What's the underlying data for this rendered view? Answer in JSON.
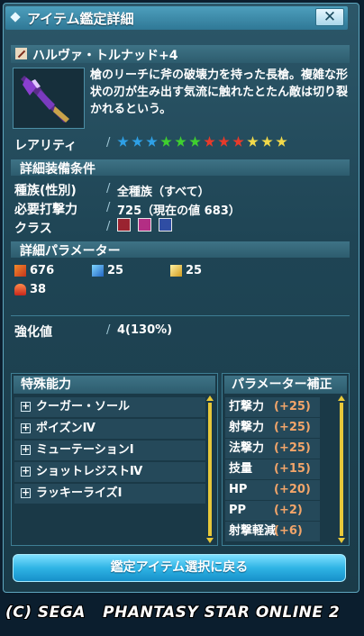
{
  "window": {
    "title": "アイテム鑑定詳細",
    "close_label": "✕"
  },
  "item": {
    "name": "ハルヴァ・トルナッド+4",
    "description": "槍のリーチに斧の破壊力を持った長槍。複雑な形状の刃が生み出す気流に触れたとたん敵は切り裂かれるという。"
  },
  "rarity": {
    "label": "レアリティ",
    "stars": [
      "#2ea0e6",
      "#2ea0e6",
      "#2ea0e6",
      "#3fcf2f",
      "#3fcf2f",
      "#3fcf2f",
      "#e83a2a",
      "#e83a2a",
      "#e83a2a",
      "#f2d94a",
      "#f2d94a",
      "#f2d94a"
    ]
  },
  "requirements": {
    "header": "詳細装備条件",
    "rows": [
      {
        "label": "種族(性別)",
        "value": "全種族（すべて）"
      },
      {
        "label": "必要打撃力",
        "value": "725（現在の値 683）"
      },
      {
        "label": "クラス",
        "value": ""
      }
    ],
    "class_icons": [
      "hunter-class-icon",
      "fighter-class-icon",
      "guardian-class-icon"
    ]
  },
  "parameters": {
    "header": "詳細パラメーター",
    "stats": [
      {
        "icon": "striking-attack-icon",
        "value": "676"
      },
      {
        "icon": "ranged-attack-icon",
        "value": "25"
      },
      {
        "icon": "technique-attack-icon",
        "value": "25"
      },
      {
        "icon": "element-fire-icon",
        "value": "38"
      }
    ]
  },
  "enhancement": {
    "label": "強化値",
    "value": "4(130%)"
  },
  "special_abilities": {
    "header": "特殊能力",
    "items": [
      "クーガー・ソール",
      "ポイズンⅣ",
      "ミューテーションⅠ",
      "ショットレジストⅣ",
      "ラッキーライズⅠ"
    ]
  },
  "param_bonus": {
    "header": "パラメーター補正",
    "items": [
      {
        "label": "打撃力",
        "value": "(+25)"
      },
      {
        "label": "射撃力",
        "value": "(+25)"
      },
      {
        "label": "法撃力",
        "value": "(+25)"
      },
      {
        "label": "技量",
        "value": "(+15)"
      },
      {
        "label": "HP",
        "value": "(+20)"
      },
      {
        "label": "PP",
        "value": "(+2)"
      },
      {
        "label": "射撃軽減",
        "value": "(+6)"
      }
    ]
  },
  "return_button": "鑑定アイテム選択に戻る",
  "copyright": "(C) SEGA   PHANTASY STAR ONLINE 2",
  "colors": {
    "accent": "#2fb4e5",
    "bonus": "#f2a56a",
    "scroll": "#e7c83a"
  }
}
